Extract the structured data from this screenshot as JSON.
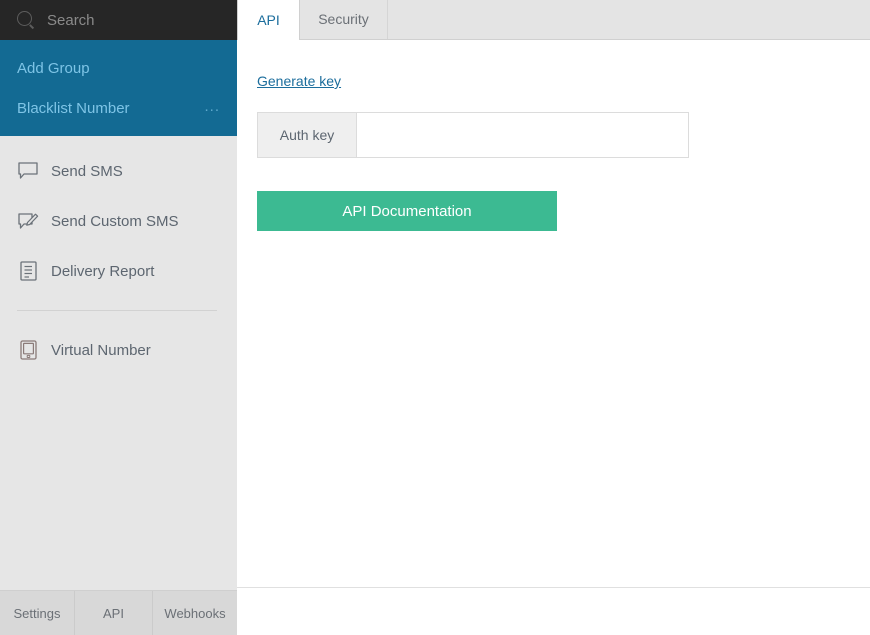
{
  "sidebar": {
    "search": {
      "placeholder": "Search",
      "value": "",
      "icon": "search-icon"
    },
    "highlighted_items": [
      {
        "label": "Add Group",
        "icon": null,
        "menu_dots": ""
      },
      {
        "label": "Blacklist Number",
        "icon": null,
        "menu_dots": "..."
      }
    ],
    "nav_items": [
      {
        "label": "Send SMS",
        "icon": "speech-bubble-icon"
      },
      {
        "label": "Send Custom SMS",
        "icon": "speech-bubble-pencil-icon"
      },
      {
        "label": "Delivery Report",
        "icon": "document-lines-icon"
      },
      {
        "label": "Virtual Number",
        "icon": "mobile-device-icon"
      }
    ]
  },
  "footer": {
    "items": [
      {
        "label": "Settings"
      },
      {
        "label": "API"
      },
      {
        "label": "Webhooks"
      }
    ]
  },
  "main": {
    "tabs": [
      {
        "label": "API",
        "active": true
      },
      {
        "label": "Security",
        "active": false
      }
    ],
    "generate_key_link": "Generate key",
    "auth_key": {
      "addon_label": "Auth key",
      "value": "",
      "placeholder": ""
    },
    "documentation_button": "API Documentation"
  },
  "colors": {
    "sidebar_bg": "#e6e6e6",
    "search_bg": "#262626",
    "highlight_blue": "#136a93",
    "highlight_text": "#7ec4e6",
    "accent_teal": "#3cba92",
    "link_blue": "#1b6d9c",
    "footer_bg": "#d8d8d8",
    "tabstrip_bg": "#e4e4e4",
    "nav_text": "#5d6670"
  }
}
